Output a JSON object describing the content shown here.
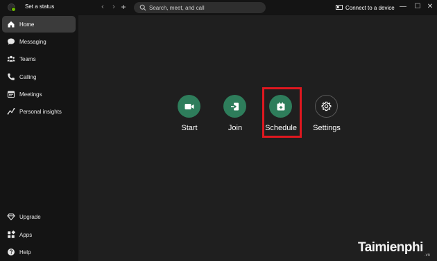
{
  "titlebar": {
    "status_label": "Set a status",
    "back_glyph": "‹",
    "forward_glyph": "›",
    "new_glyph": "+",
    "search_placeholder": "Search, meet, and call",
    "connect_label": "Connect to a device",
    "minimize_glyph": "—",
    "maximize_glyph": "☐",
    "close_glyph": "✕"
  },
  "sidebar": {
    "top_items": [
      {
        "label": "Home",
        "icon": "home-icon",
        "active": true
      },
      {
        "label": "Messaging",
        "icon": "chat-icon"
      },
      {
        "label": "Teams",
        "icon": "teams-icon"
      },
      {
        "label": "Calling",
        "icon": "phone-icon"
      },
      {
        "label": "Meetings",
        "icon": "calendar-icon"
      },
      {
        "label": "Personal insights",
        "icon": "insights-icon"
      }
    ],
    "bottom_items": [
      {
        "label": "Upgrade",
        "icon": "diamond-icon"
      },
      {
        "label": "Apps",
        "icon": "apps-icon"
      },
      {
        "label": "Help",
        "icon": "help-icon"
      }
    ]
  },
  "main": {
    "actions": [
      {
        "label": "Start",
        "icon": "video-camera-icon"
      },
      {
        "label": "Join",
        "icon": "join-icon"
      },
      {
        "label": "Schedule",
        "icon": "calendar-add-icon",
        "highlighted": true
      },
      {
        "label": "Settings",
        "icon": "gear-icon"
      }
    ]
  },
  "colors": {
    "accent_green": "#2e7d5b",
    "highlight_red": "#e0171f",
    "sidebar_bg": "#141414",
    "main_bg": "#1f1f1f"
  },
  "watermark": {
    "text": "Taimienphi",
    "tld": ".vn"
  }
}
